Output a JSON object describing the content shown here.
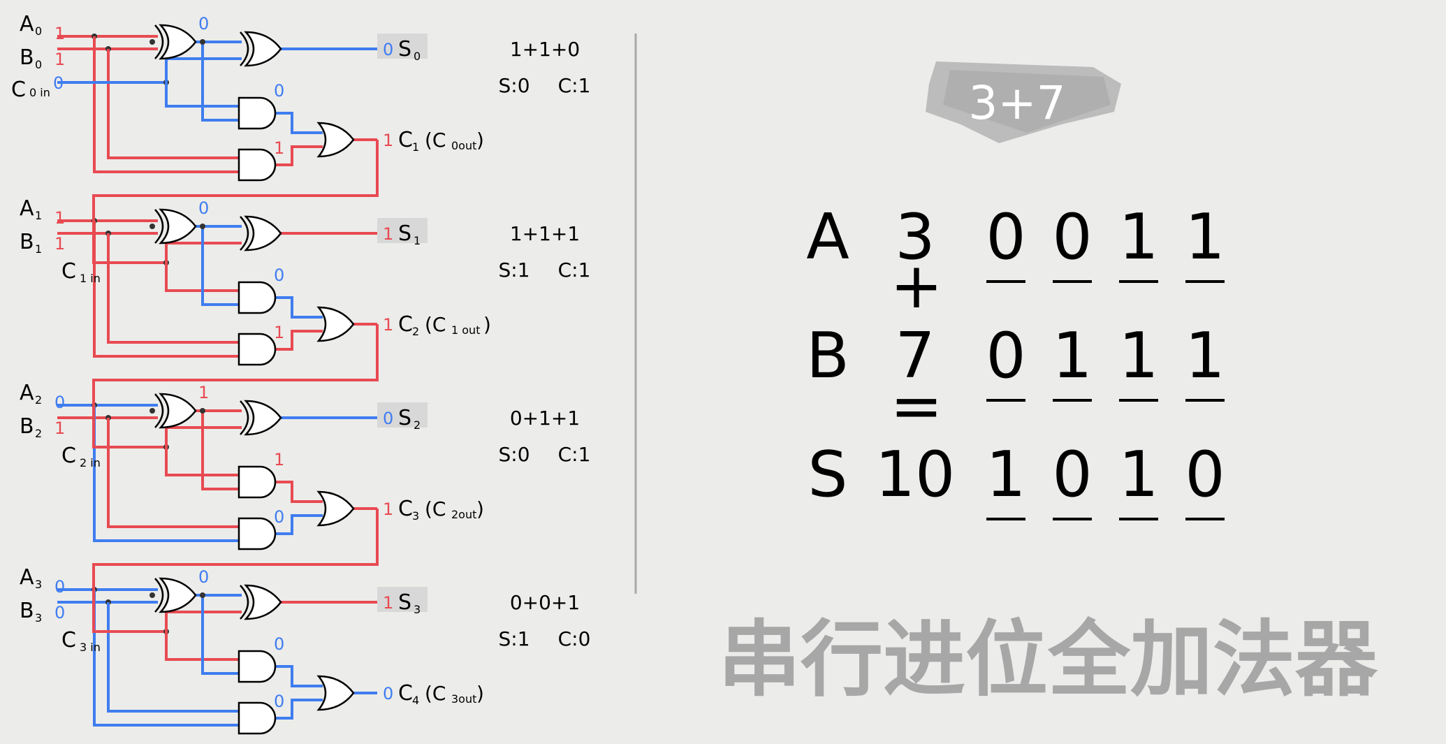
{
  "colors": {
    "one": "#e84a52",
    "zero": "#3f7df0",
    "wire_one": "#e84a52",
    "wire_zero": "#3f7df0",
    "title": "#a7a7a7"
  },
  "stages": [
    {
      "a_label": "A",
      "a_sub": "0",
      "a_bit": "1",
      "b_label": "B",
      "b_sub": "0",
      "b_bit": "1",
      "c_label": "C",
      "c_sub": "0 in",
      "c_bit": "0",
      "xor1_out": "0",
      "and1_out": "0",
      "and2_out": "1",
      "s_bit": "0",
      "s_label": "S",
      "s_sub": "0",
      "carry_bit": "1",
      "carry_label": "C",
      "carry_sub": "1",
      "carry_paren_label": "(C",
      "carry_paren_sub": "0out",
      "carry_paren_close": ")",
      "eq": "1+1+0",
      "s_text": "S:0",
      "c_text": "C:1"
    },
    {
      "a_label": "A",
      "a_sub": "1",
      "a_bit": "1",
      "b_label": "B",
      "b_sub": "1",
      "b_bit": "1",
      "c_label": "C",
      "c_sub": "1 in",
      "c_bit": "",
      "xor1_out": "0",
      "and1_out": "0",
      "and2_out": "1",
      "s_bit": "1",
      "s_label": "S",
      "s_sub": "1",
      "carry_bit": "1",
      "carry_label": "C",
      "carry_sub": "2",
      "carry_paren_label": "(C",
      "carry_paren_sub": "1 out",
      "carry_paren_close": ")",
      "eq": "1+1+1",
      "s_text": "S:1",
      "c_text": "C:1"
    },
    {
      "a_label": "A",
      "a_sub": "2",
      "a_bit": "0",
      "b_label": "B",
      "b_sub": "2",
      "b_bit": "1",
      "c_label": "C",
      "c_sub": "2 in",
      "c_bit": "",
      "xor1_out": "1",
      "and1_out": "1",
      "and2_out": "0",
      "s_bit": "0",
      "s_label": "S",
      "s_sub": "2",
      "carry_bit": "1",
      "carry_label": "C",
      "carry_sub": "3",
      "carry_paren_label": "(C",
      "carry_paren_sub": "2out",
      "carry_paren_close": ")",
      "eq": "0+1+1",
      "s_text": "S:0",
      "c_text": "C:1"
    },
    {
      "a_label": "A",
      "a_sub": "3",
      "a_bit": "0",
      "b_label": "B",
      "b_sub": "3",
      "b_bit": "0",
      "c_label": "C",
      "c_sub": "3 in",
      "c_bit": "",
      "xor1_out": "0",
      "and1_out": "0",
      "and2_out": "0",
      "s_bit": "1",
      "s_label": "S",
      "s_sub": "3",
      "carry_bit": "0",
      "carry_label": "C",
      "carry_sub": "4",
      "carry_paren_label": "(C",
      "carry_paren_sub": "3out",
      "carry_paren_close": ")",
      "eq": "0+0+1",
      "s_text": "S:1",
      "c_text": "C:0"
    }
  ],
  "problem": "3+7",
  "table": {
    "rows": [
      {
        "label": "A",
        "dec": "3",
        "bits": [
          "0",
          "0",
          "1",
          "1"
        ]
      },
      {
        "label": "B",
        "dec": "7",
        "bits": [
          "0",
          "1",
          "1",
          "1"
        ]
      },
      {
        "label": "S",
        "dec": "10",
        "bits": [
          "1",
          "0",
          "1",
          "0"
        ]
      }
    ],
    "plus": "+",
    "equals": "="
  },
  "title": "串行进位全加法器"
}
